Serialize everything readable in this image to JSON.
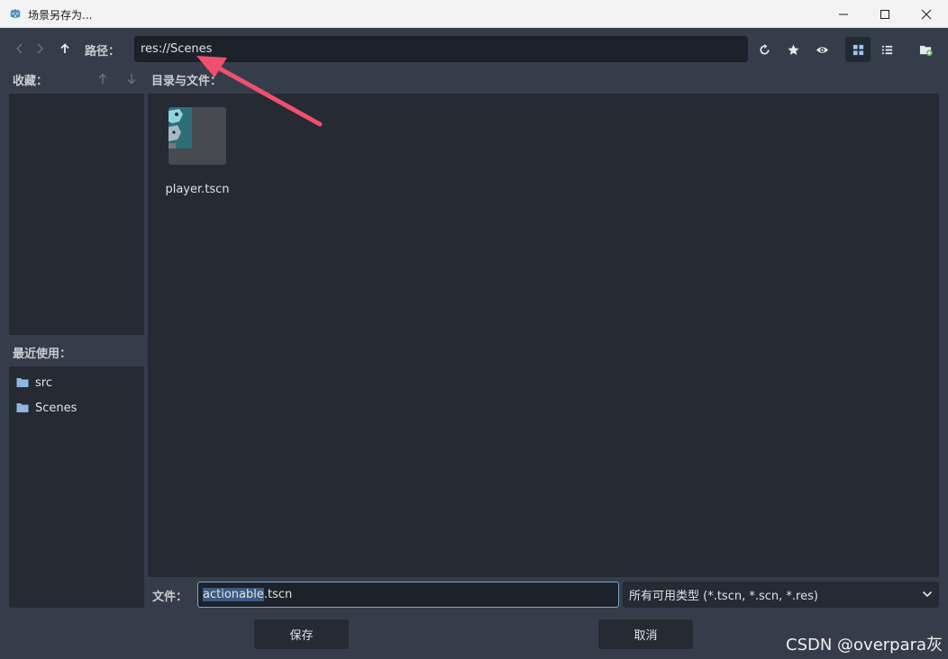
{
  "window": {
    "title": "场景另存为..."
  },
  "toolbar": {
    "path_label": "路径：",
    "path_value": "res://Scenes"
  },
  "favorites": {
    "label": "收藏："
  },
  "recent": {
    "label": "最近使用：",
    "items": [
      {
        "label": "src"
      },
      {
        "label": "Scenes"
      }
    ]
  },
  "files": {
    "label": "目录与文件：",
    "items": [
      {
        "name": "player.tscn"
      }
    ]
  },
  "bottom": {
    "file_label": "文件：",
    "filename_selected": "actionable",
    "filename_rest": ".tscn",
    "filter_value": "所有可用类型 (*.tscn, *.scn, *.res)",
    "save_label": "保存",
    "cancel_label": "取消"
  },
  "watermark": "CSDN @overpara灰",
  "colors": {
    "background": "#363d4a",
    "panel": "#252a33",
    "input": "#1d2129",
    "accent": "#7aa4d3",
    "annotation_arrow": "#f0506e"
  }
}
